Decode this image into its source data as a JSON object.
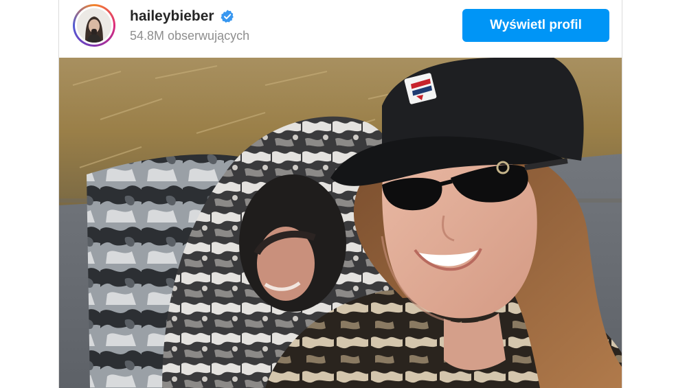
{
  "post_header": {
    "username": "haileybieber",
    "verified": true,
    "followers_text": "54.8M obserwujących",
    "view_profile_label": "Wyświetl profil",
    "button_color": "#0095f6"
  },
  "icons": {
    "verified": "verified-badge-icon"
  },
  "photo": {
    "cap_logo": "FILA"
  }
}
